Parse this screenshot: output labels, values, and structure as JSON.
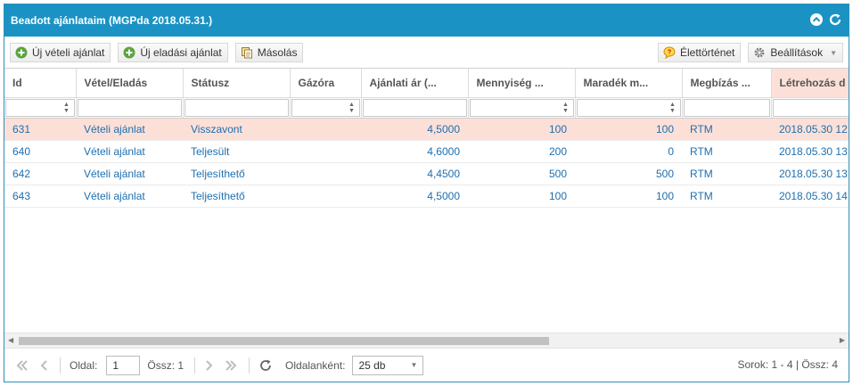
{
  "window": {
    "title": "Beadott ajánlataim (MGPda 2018.05.31.)",
    "tools": [
      {
        "icon": "collapse-up-icon"
      },
      {
        "icon": "refresh-icon"
      }
    ]
  },
  "toolbar": {
    "new_buy_label": "Új vételi ajánlat",
    "new_sell_label": "Új eladási ajánlat",
    "copy_label": "Másolás",
    "history_label": "Élettörténet",
    "settings_label": "Beállítások"
  },
  "grid": {
    "columns": [
      {
        "label": "Id",
        "filter": "spin"
      },
      {
        "label": "Vétel/Eladás",
        "filter": "text"
      },
      {
        "label": "Státusz",
        "filter": "text"
      },
      {
        "label": "Gázóra",
        "filter": "spin"
      },
      {
        "label": "Ajánlati ár (...",
        "filter": "text"
      },
      {
        "label": "Mennyiség ...",
        "filter": "spin"
      },
      {
        "label": "Maradék m...",
        "filter": "spin"
      },
      {
        "label": "Megbízás ...",
        "filter": "text"
      },
      {
        "label": "Létrehozás d",
        "filter": "text"
      }
    ],
    "rows": [
      {
        "id": "631",
        "side": "Vételi ajánlat",
        "status": "Visszavont",
        "meter": "",
        "price": "4,5000",
        "qty": "100",
        "remaining": "100",
        "order": "RTM",
        "created": "2018.05.30 12",
        "selected": true
      },
      {
        "id": "640",
        "side": "Vételi ajánlat",
        "status": "Teljesült",
        "meter": "",
        "price": "4,6000",
        "qty": "200",
        "remaining": "0",
        "order": "RTM",
        "created": "2018.05.30 13",
        "selected": false
      },
      {
        "id": "642",
        "side": "Vételi ajánlat",
        "status": "Teljesíthető",
        "meter": "",
        "price": "4,4500",
        "qty": "500",
        "remaining": "500",
        "order": "RTM",
        "created": "2018.05.30 13",
        "selected": false
      },
      {
        "id": "643",
        "side": "Vételi ajánlat",
        "status": "Teljesíthető",
        "meter": "",
        "price": "4,5000",
        "qty": "100",
        "remaining": "100",
        "order": "RTM",
        "created": "2018.05.30 14",
        "selected": false
      }
    ]
  },
  "pager": {
    "page_label": "Oldal:",
    "page_value": "1",
    "total_label": "Össz: 1",
    "per_page_label": "Oldalanként:",
    "per_page_value": "25 db",
    "rows_info": "Sorok: 1 - 4 | Össz: 4"
  },
  "colors": {
    "titlebar": "#1a93c4",
    "selected_row": "#fce0d8",
    "link_text": "#1d6fb0"
  }
}
